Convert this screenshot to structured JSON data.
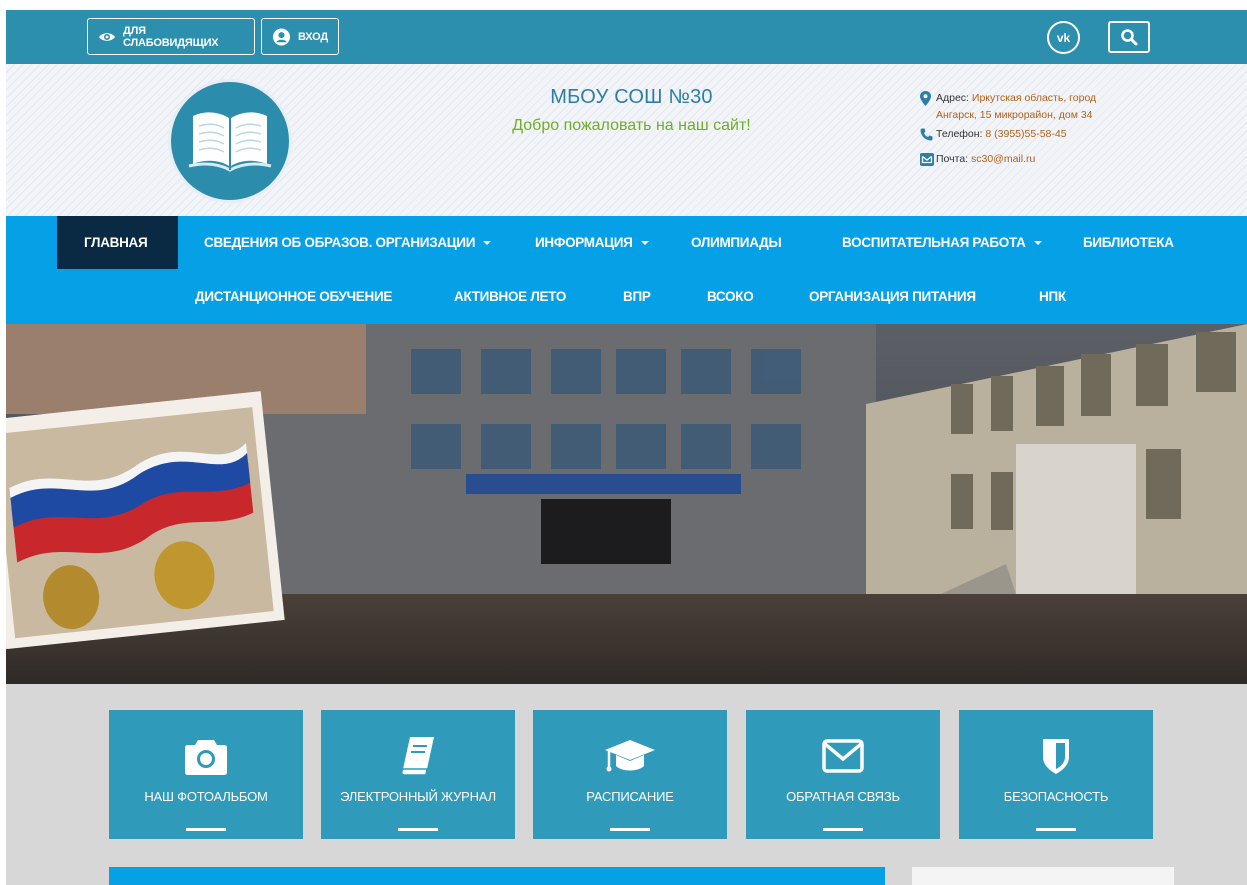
{
  "topbar": {
    "low_vision_label": "для слабовидящих",
    "login_label": "вход",
    "vk_label": "vk",
    "search_icon": "search-icon",
    "colors": {
      "bar": "#2c8fad"
    }
  },
  "header": {
    "title": "МБОУ СОШ №30",
    "subtitle": "Добро пожаловать на наш сайт!",
    "address_label": "Адрес:",
    "address_value_1": "Иркутская область, город",
    "address_value_2": "Ангарск, 15 микрорайон, дом 34",
    "phone_label": "Телефон:",
    "phone_value": "8 (3955)55-58-45",
    "email_label": "Почта:",
    "email_value": "sc30@mail.ru",
    "logo_icon": "open-book-icon"
  },
  "nav": {
    "items": [
      {
        "label": "ГЛАВНАЯ",
        "active": true
      },
      {
        "label": "СВЕДЕНИЯ ОБ ОБРАЗОВ. ОРГАНИЗАЦИИ",
        "dropdown": true
      },
      {
        "label": "ИНФОРМАЦИЯ",
        "dropdown": true
      },
      {
        "label": "ОЛИМПИАДЫ"
      },
      {
        "label": "ВОСПИТАТЕЛЬНАЯ РАБОТА",
        "dropdown": true
      },
      {
        "label": "БИБЛИОТЕКА"
      },
      {
        "label": "ДИСТАНЦИОННОЕ ОБУЧЕНИЕ"
      },
      {
        "label": "АКТИВНОЕ ЛЕТО"
      },
      {
        "label": "ВПР"
      },
      {
        "label": "ВСОКО"
      },
      {
        "label": "ОРГАНИЗАЦИЯ ПИТАНИЯ"
      },
      {
        "label": "НПК"
      }
    ],
    "colors": {
      "bar": "#05a0e6",
      "active": "#0a2a44"
    }
  },
  "banner": {
    "description_icon": "school-building-photo"
  },
  "tiles": [
    {
      "label": "НАШ ФОТОАЛЬБОМ",
      "icon": "camera-icon"
    },
    {
      "label": "ЭЛЕКТРОННЫЙ ЖУРНАЛ",
      "icon": "book-icon"
    },
    {
      "label": "РАСПИСАНИЕ",
      "icon": "graduation-cap-icon"
    },
    {
      "label": "ОБРАТНАЯ СВЯЗЬ",
      "icon": "envelope-icon"
    },
    {
      "label": "БЕЗОПАСНОСТЬ",
      "icon": "shield-icon"
    }
  ]
}
